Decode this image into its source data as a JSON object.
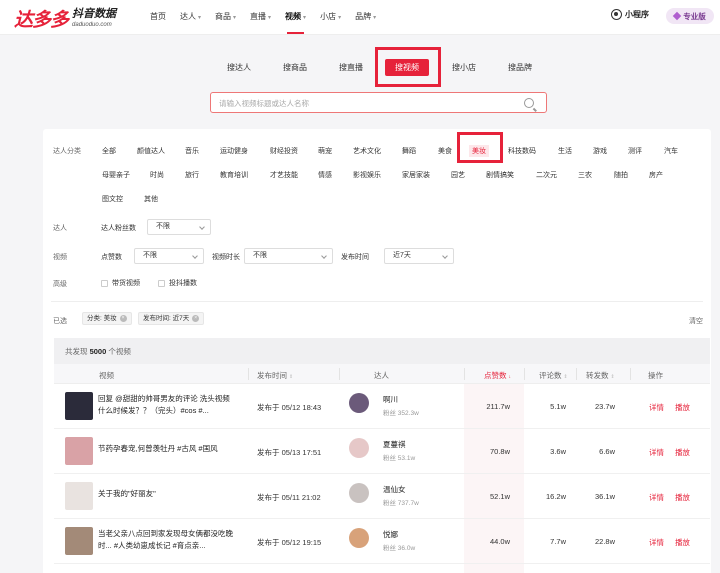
{
  "header": {
    "logo_main": "达多多",
    "logo_cn": "抖音数据",
    "logo_en": "daduoduo.com",
    "nav": [
      {
        "label": "首页",
        "caret": false
      },
      {
        "label": "达人",
        "caret": true
      },
      {
        "label": "商品",
        "caret": true
      },
      {
        "label": "直播",
        "caret": true
      },
      {
        "label": "视频",
        "caret": true,
        "active": true
      },
      {
        "label": "小店",
        "caret": true
      },
      {
        "label": "品牌",
        "caret": true
      }
    ],
    "mini_program": "小程序",
    "pro_badge": "专业版"
  },
  "search_tabs": [
    "搜达人",
    "搜商品",
    "搜直播",
    "搜视频",
    "搜小店",
    "搜品牌"
  ],
  "search_active": "搜视频",
  "search": {
    "placeholder": "请输入视频标题或达人名称",
    "value": ""
  },
  "filters": {
    "category_label": "达人分类",
    "categories_row1": [
      "全部",
      "颜值达人",
      "音乐",
      "运动健身",
      "财经投资",
      "萌宠",
      "艺术文化",
      "舞蹈",
      "美食",
      "美妆",
      "科技数码",
      "生活",
      "游戏",
      "测评",
      "汽车"
    ],
    "categories_row2": [
      "母婴亲子",
      "时尚",
      "旅行",
      "教育培训",
      "才艺技能",
      "情感",
      "影视娱乐",
      "家居家装",
      "园艺",
      "剧情搞笑",
      "二次元",
      "三农",
      "随拍",
      "房产"
    ],
    "categories_row3": [
      "图文控",
      "其他"
    ],
    "active_category": "美妆",
    "influencer_label": "达人",
    "fans_label": "达人粉丝数",
    "fans_value": "不限",
    "video_label": "视频",
    "likes_label": "点赞数",
    "likes_value": "不限",
    "duration_label": "视频时长",
    "duration_value": "不限",
    "publish_label": "发布时间",
    "publish_value": "近7天",
    "advanced_label": "高级",
    "with_goods": "带货视频",
    "ad_boost": "投抖播数",
    "selected_label": "已选",
    "selected_tags": [
      "分类: 美妆",
      "发布时间: 近7天"
    ],
    "clear": "清空"
  },
  "results": {
    "summary_prefix": "共发现",
    "summary_count": "5000",
    "summary_suffix": "个视频",
    "columns": {
      "video": "视频",
      "publish_time": "发布时间",
      "influencer": "达人",
      "likes": "点赞数",
      "comments": "评论数",
      "shares": "转发数",
      "actions": "操作"
    },
    "detail_label": "详情",
    "play_label": "播放",
    "rows": [
      {
        "title": "回复 @甜甜的帅哥男友的评论 洗头视频什么时候发？？（完头）#cos #...",
        "time": "发布于 05/12 18:43",
        "name": "啊川",
        "fans": "粉丝 352.3w",
        "likes": "211.7w",
        "comments": "5.1w",
        "shares": "23.7w",
        "thumb_color": "#2b2b3a",
        "avatar_color": "#6b5a7a"
      },
      {
        "title": "节药孕春宠,何曾羡牡丹 #古风 #国风",
        "time": "发布于 05/13 17:51",
        "name": "夏蔓祺",
        "fans": "粉丝 53.1w",
        "likes": "70.8w",
        "comments": "3.6w",
        "shares": "6.6w",
        "thumb_color": "#d9a2a6",
        "avatar_color": "#e6c8c8"
      },
      {
        "title": "关于我的\"好丽友\"",
        "time": "发布于 05/11 21:02",
        "name": "温仙女",
        "fans": "粉丝 737.7w",
        "likes": "52.1w",
        "comments": "16.2w",
        "shares": "36.1w",
        "thumb_color": "#e9e3e0",
        "avatar_color": "#c9c2c0"
      },
      {
        "title": "当老父亲八点回到家发现母女俩都没吃晚时... #人类幼崽成长记 #育点亲...",
        "time": "发布于 05/12 19:15",
        "name": "悦娜",
        "fans": "粉丝 36.0w",
        "likes": "44.0w",
        "comments": "7.7w",
        "shares": "22.8w",
        "thumb_color": "#a38a78",
        "avatar_color": "#d8a27a"
      }
    ]
  }
}
